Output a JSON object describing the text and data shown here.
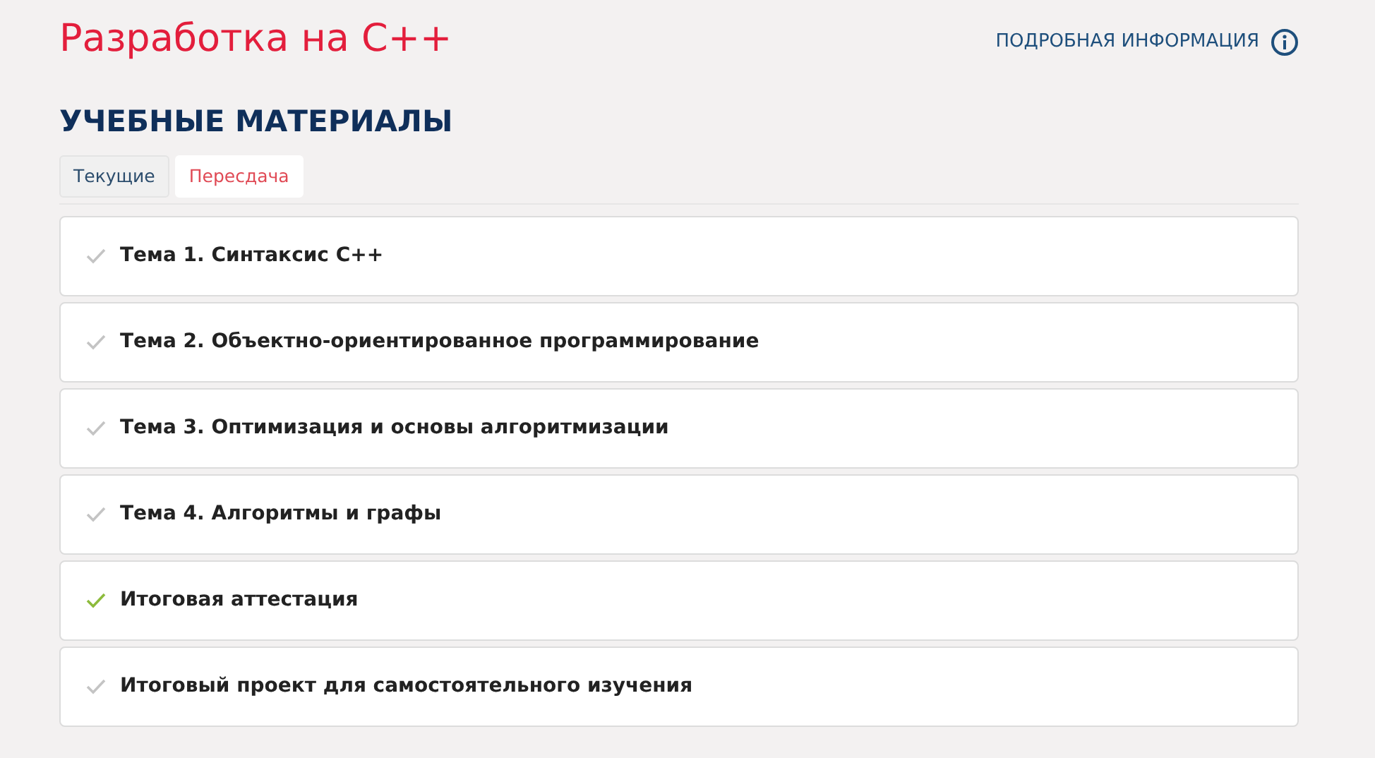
{
  "title": "Разработка на С++",
  "info_link": "ПОДРОБНАЯ ИНФОРМАЦИЯ",
  "section_title": "УЧЕБНЫЕ МАТЕРИАЛЫ",
  "tabs": [
    {
      "label": "Текущие",
      "selected": false
    },
    {
      "label": "Пересдача",
      "selected": true
    }
  ],
  "topics": [
    {
      "title": "Тема 1. Синтаксис С++",
      "completed": false
    },
    {
      "title": "Тема 2. Объектно-ориентированное программирование",
      "completed": false
    },
    {
      "title": "Тема 3. Оптимизация и основы алгоритмизации",
      "completed": false
    },
    {
      "title": "Тема 4. Алгоритмы и графы",
      "completed": false
    },
    {
      "title": "Итоговая аттестация",
      "completed": true
    },
    {
      "title": "Итоговый проект для самостоятельного изучения",
      "completed": false
    }
  ]
}
